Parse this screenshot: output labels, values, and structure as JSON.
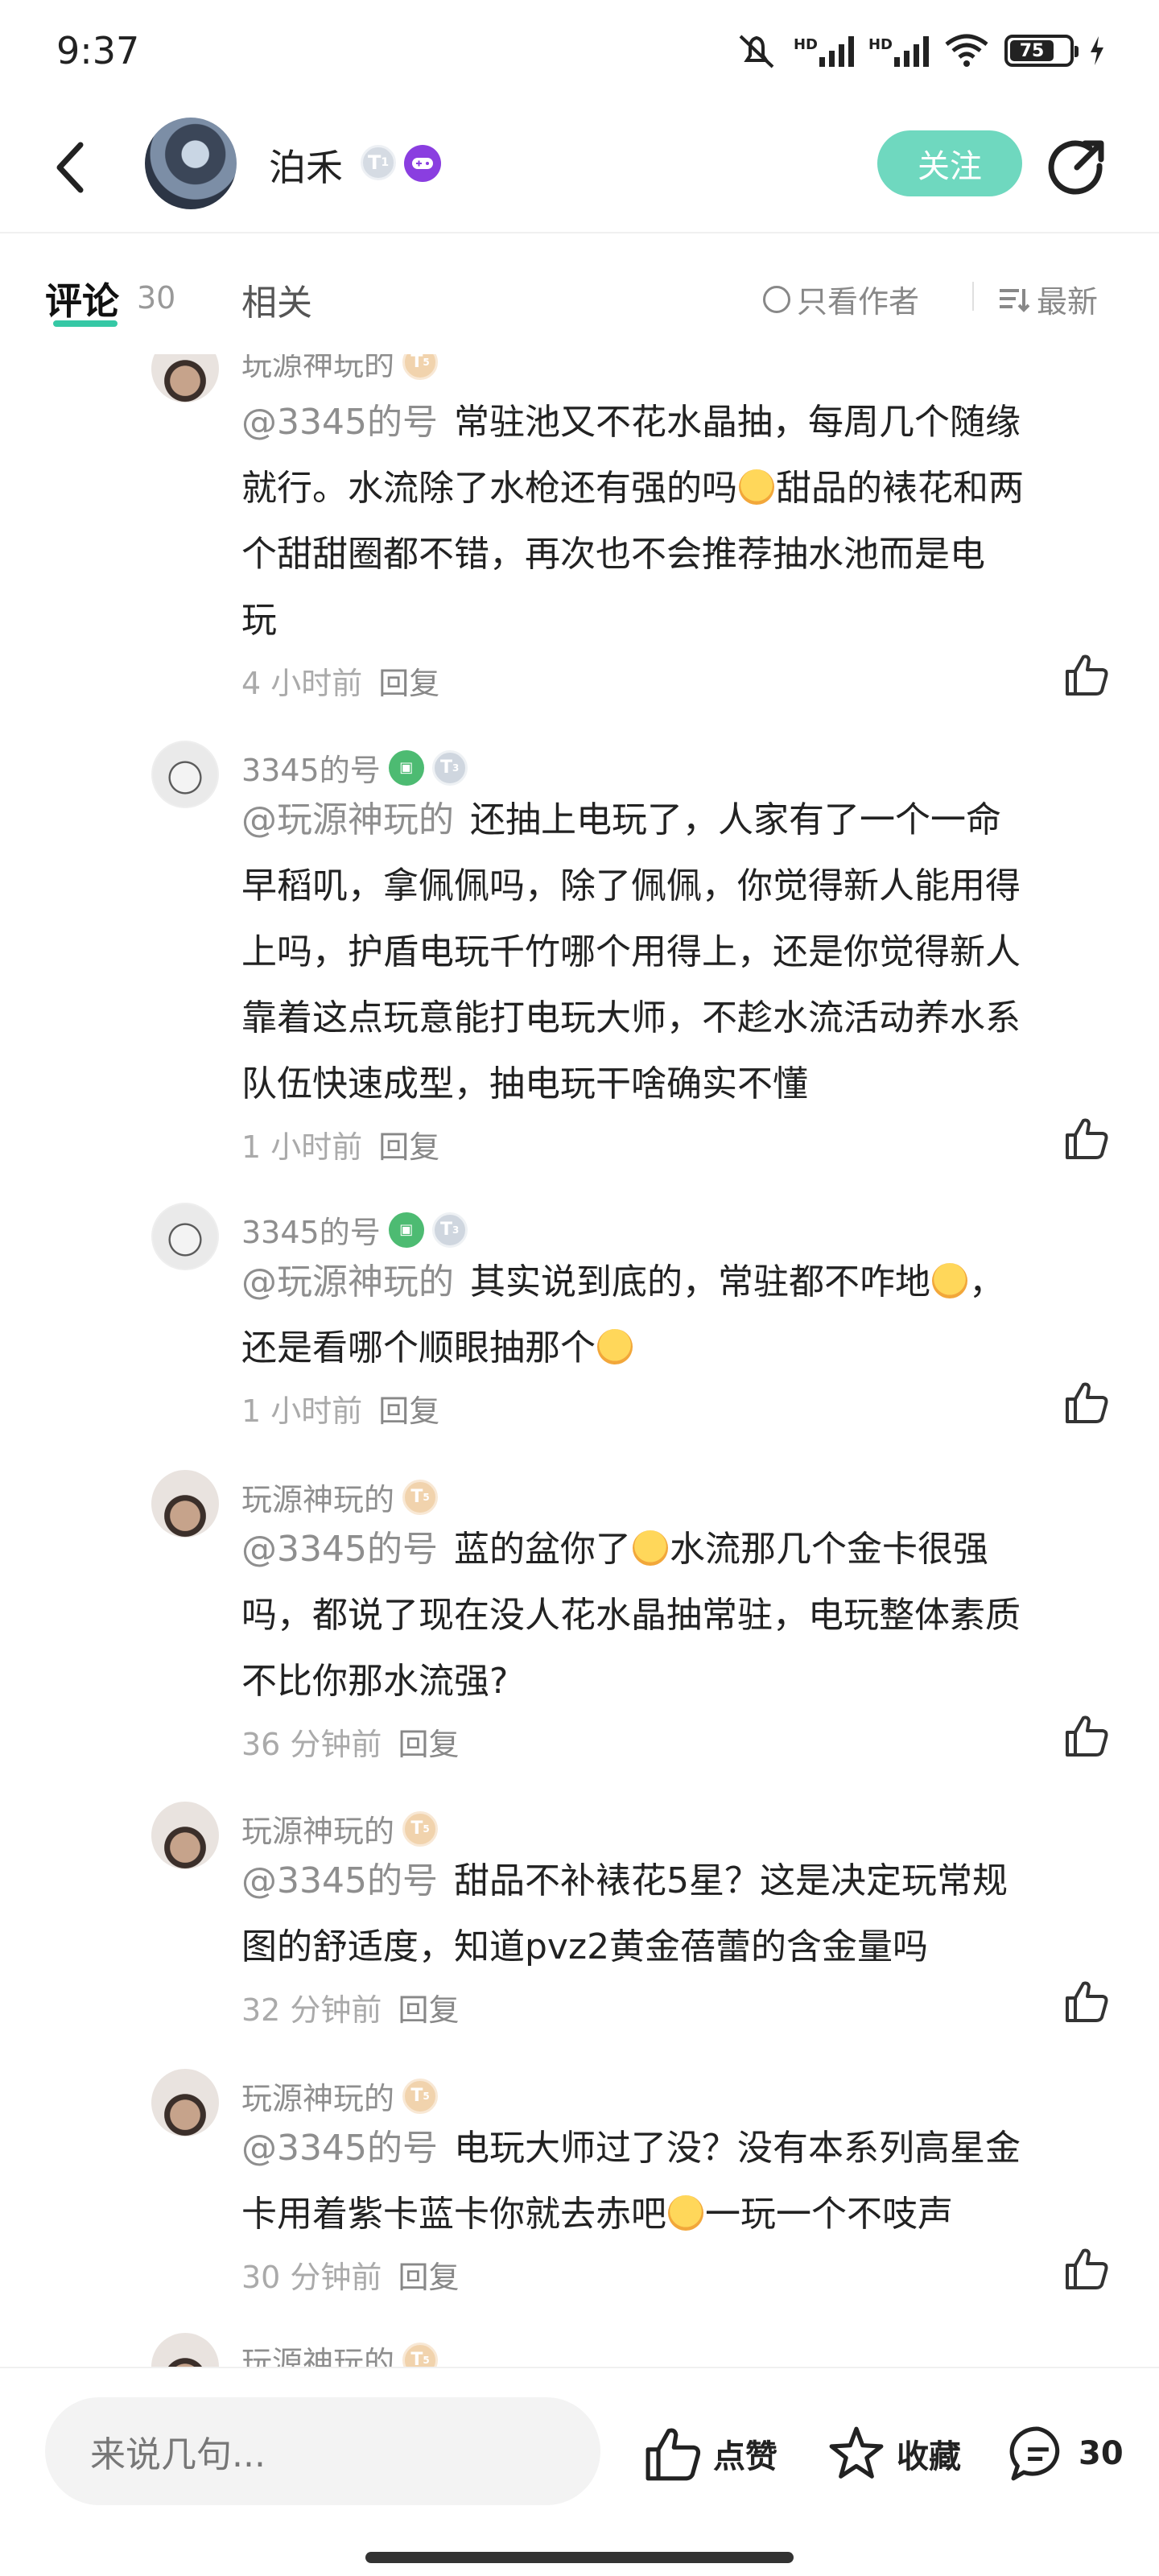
{
  "status_bar": {
    "time": "9:37",
    "battery": "75",
    "hd": "HD"
  },
  "header": {
    "author_name": "泊禾",
    "author_level": "1",
    "follow_label": "关注"
  },
  "tabs": {
    "comment_label": "评论",
    "comment_count": "30",
    "related_label": "相关",
    "only_author_label": "只看作者",
    "sort_label": "最新"
  },
  "comments": [
    {
      "user": "玩源神玩的",
      "level": "5",
      "mention": "@3345的号",
      "lines": [
        "常驻池又不花水晶抽，每周几个随缘",
        "就行。水流除了水枪还有强的吗",
        "甜品的裱花和两",
        "个甜甜圈都不错，再次也不会推荐抽水池而是电",
        "玩"
      ],
      "time": "4 小时前",
      "reply": "回复"
    },
    {
      "user": "3345的号",
      "level": "3",
      "mention": "@玩源神玩的",
      "lines": [
        "还抽上电玩了，人家有了一个一命",
        "早稻叽，拿佩佩吗，除了佩佩，你觉得新人能用得",
        "上吗，护盾电玩千竹哪个用得上，还是你觉得新人",
        "靠着这点玩意能打电玩大师，不趁水流活动养水系",
        "队伍快速成型，抽电玩干啥确实不懂"
      ],
      "time": "1 小时前",
      "reply": "回复"
    },
    {
      "user": "3345的号",
      "level": "3",
      "mention": "@玩源神玩的",
      "lines": [
        "其实说到底的，常驻都不咋地",
        "，",
        "还是看哪个顺眼抽那个"
      ],
      "time": "1 小时前",
      "reply": "回复"
    },
    {
      "user": "玩源神玩的",
      "level": "5",
      "mention": "@3345的号",
      "lines": [
        "蓝的盆你了",
        "水流那几个金卡很强",
        "吗，都说了现在没人花水晶抽常驻，电玩整体素质",
        "不比你那水流强?"
      ],
      "time": "36 分钟前",
      "reply": "回复"
    },
    {
      "user": "玩源神玩的",
      "level": "5",
      "mention": "@3345的号",
      "lines": [
        "甜品不补裱花5星？这是决定玩常规",
        "图的舒适度，知道pvz2黄金蓓蕾的含金量吗"
      ],
      "time": "32 分钟前",
      "reply": "回复"
    },
    {
      "user": "玩源神玩的",
      "level": "5",
      "mention": "@3345的号",
      "lines": [
        "电玩大师过了没？没有本系列高星金",
        "卡用着紫卡蓝卡你就去赤吧",
        "一玩一个不吱声"
      ],
      "time": "30 分钟前",
      "reply": "回复"
    },
    {
      "user": "玩源神玩的",
      "level": "5"
    }
  ],
  "bottom": {
    "input_placeholder": "来说几句...",
    "like_label": "点赞",
    "fav_label": "收藏",
    "comment_count": "30"
  }
}
